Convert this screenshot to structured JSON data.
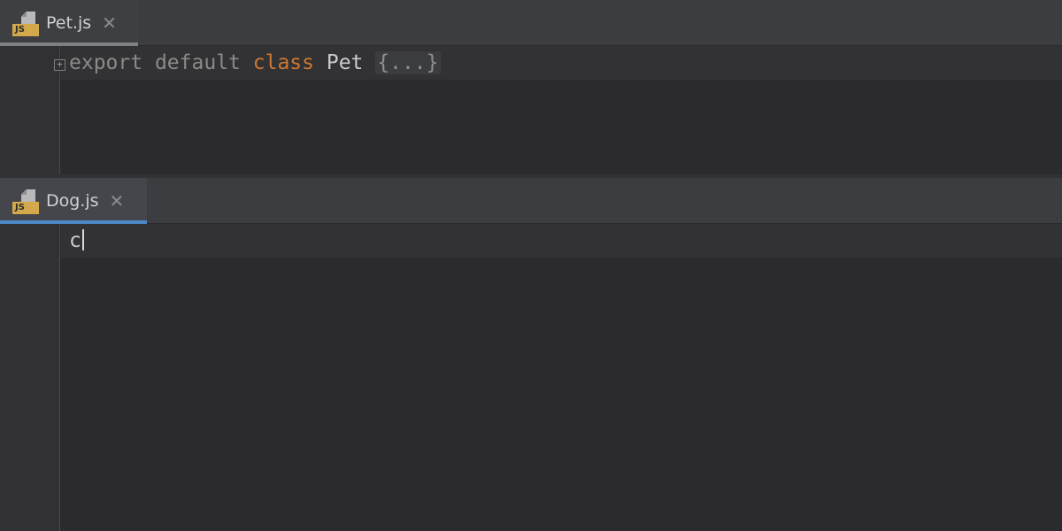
{
  "top_pane": {
    "tab": {
      "label": "Pet.js",
      "icon_badge": "JS",
      "close_glyph": "✕"
    },
    "code": {
      "tokens": [
        "export",
        "default",
        "class",
        "Pet",
        "{...}"
      ],
      "fold_marker": "+"
    }
  },
  "bottom_pane": {
    "tab": {
      "label": "Dog.js",
      "icon_badge": "JS",
      "close_glyph": "✕"
    },
    "code": {
      "typed_text": "c"
    }
  },
  "colors": {
    "keyword_orange": "#cc7832",
    "active_tab_underline": "#4a88c7",
    "js_badge": "#d4a94b"
  }
}
